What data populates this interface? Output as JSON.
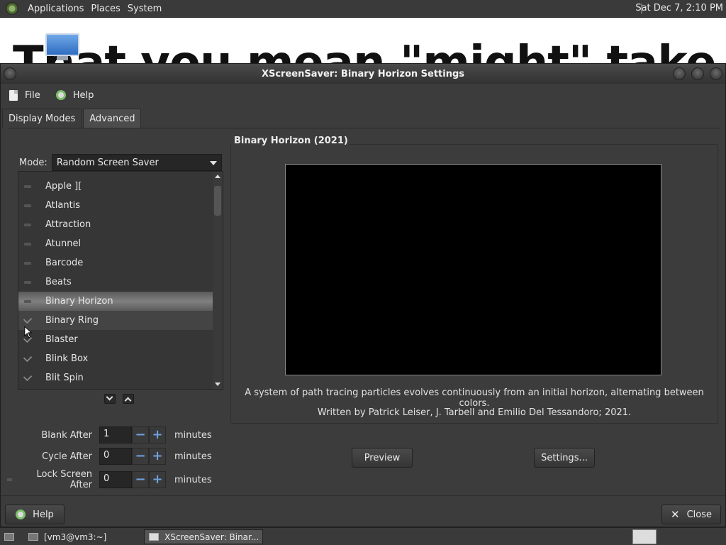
{
  "top_panel": {
    "menus": [
      "Applications",
      "Places",
      "System"
    ],
    "clock": "Sat Dec  7,  2:10 PM"
  },
  "desktop": {
    "background_text": "That you mean \"might\" take a look at me"
  },
  "window": {
    "title": "XScreenSaver: Binary Horizon Settings",
    "menubar": {
      "file": "File",
      "help": "Help"
    },
    "tabs": {
      "display_modes": "Display Modes",
      "advanced": "Advanced"
    },
    "mode": {
      "label": "Mode:",
      "value": "Random Screen Saver"
    },
    "list_items": [
      {
        "label": "Apple ][",
        "checked": false
      },
      {
        "label": "Atlantis",
        "checked": false
      },
      {
        "label": "Attraction",
        "checked": false
      },
      {
        "label": "Atunnel",
        "checked": false
      },
      {
        "label": "Barcode",
        "checked": false
      },
      {
        "label": "Beats",
        "checked": false
      },
      {
        "label": "Binary Horizon",
        "checked": false
      },
      {
        "label": "Binary Ring",
        "checked": true
      },
      {
        "label": "Blaster",
        "checked": true
      },
      {
        "label": "Blink Box",
        "checked": true
      },
      {
        "label": "Blit Spin",
        "checked": true
      }
    ],
    "timing": {
      "blank_after": {
        "label": "Blank After",
        "value": "1",
        "unit": "minutes"
      },
      "cycle_after": {
        "label": "Cycle After",
        "value": "0",
        "unit": "minutes"
      },
      "lock_after": {
        "label": "Lock Screen After",
        "value": "0",
        "unit": "minutes"
      }
    },
    "preview": {
      "frame_title": "Binary Horizon (2021)",
      "description": "A system of path tracing particles evolves continuously from an initial horizon, alternating between colors.",
      "credits": "Written by Patrick Leiser, J. Tarbell and Emilio Del Tessandoro; 2021.",
      "preview_button": "Preview",
      "settings_button": "Settings..."
    },
    "bottom": {
      "help_button": "Help",
      "close_button": "Close"
    }
  },
  "taskbar": {
    "tasks": [
      "[vm3@vm3:~]",
      "XScreenSaver: Binar..."
    ]
  },
  "colors": {
    "window_bg": "#3c3c3c",
    "accent_spin": "#6ea0e0",
    "help_icon": "#7fbf6a"
  }
}
